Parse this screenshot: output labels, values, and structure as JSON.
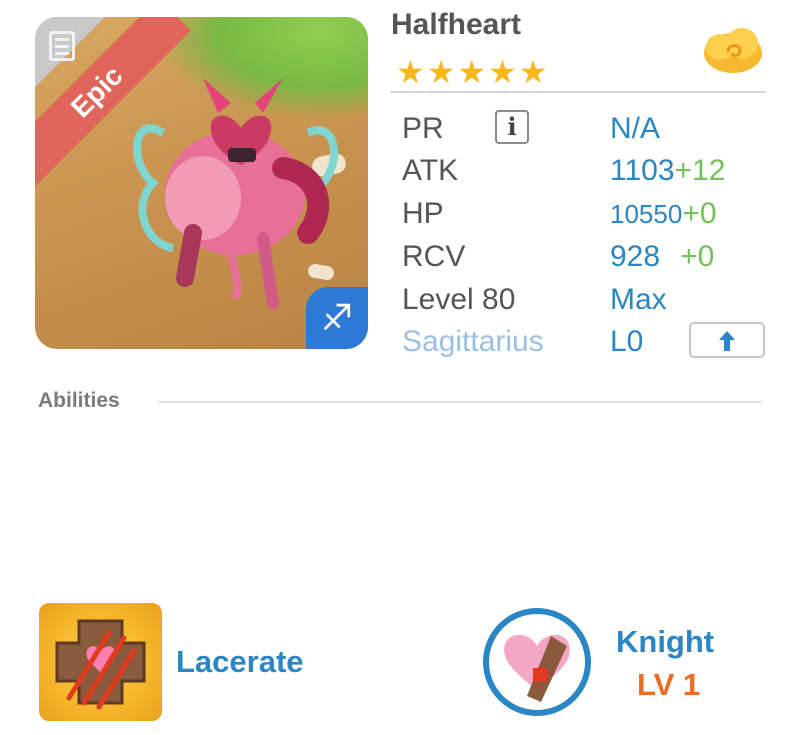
{
  "hero": {
    "name": "Halfheart",
    "stars_display": "★★★★★",
    "star_count": 5,
    "rarity": "Epic",
    "zodiac_symbol": "♐"
  },
  "stats": {
    "pr_label": "PR",
    "pr_value": "N/A",
    "info_glyph": "i",
    "atk_label": "ATK",
    "atk_value": "1103",
    "atk_bonus": "+12",
    "hp_label": "HP",
    "hp_value": "10550",
    "hp_bonus": "+0",
    "rcv_label": "RCV",
    "rcv_value": "928",
    "rcv_bonus": "+0",
    "level_label": "Level 80",
    "level_value": "Max",
    "sign_label": "Sagittarius",
    "sign_level": "L0"
  },
  "abilities": {
    "heading": "Abilities",
    "skill_name": "Lacerate",
    "class_name": "Knight",
    "class_level": "LV 1"
  },
  "colors": {
    "accent_blue": "#2a86c5",
    "bonus_green": "#73c25b",
    "star_gold": "#f6b81c",
    "epic_red": "#e0655a",
    "level_orange": "#f06a21",
    "sign_label_blue": "#9cc0e4"
  },
  "icons": {
    "card_detail": "document-icon",
    "currency": "cloud-swirl-icon",
    "zodiac": "sagittarius-arrow-icon",
    "upgrade": "up-arrow-icon",
    "skill": "lacerate-cross-icon",
    "class": "knight-heart-shield-icon"
  }
}
